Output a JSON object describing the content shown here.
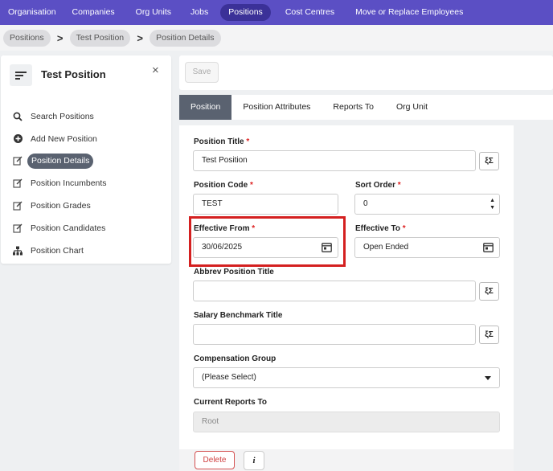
{
  "topnav": {
    "items": [
      {
        "label": "Organisation"
      },
      {
        "label": "Companies"
      },
      {
        "label": "Org Units"
      },
      {
        "label": "Jobs"
      },
      {
        "label": "Positions",
        "active": true
      },
      {
        "label": "Cost Centres"
      },
      {
        "label": "Move or Replace Employees"
      }
    ]
  },
  "breadcrumb": {
    "items": [
      "Positions",
      "Test Position",
      "Position Details"
    ],
    "separator": ">"
  },
  "leftpanel": {
    "title": "Test Position",
    "close_label": "×",
    "items": [
      {
        "label": "Search Positions",
        "icon": "search-icon"
      },
      {
        "label": "Add New Position",
        "icon": "plus-circle-icon"
      },
      {
        "label": "Position Details",
        "icon": "edit-icon",
        "active": true
      },
      {
        "label": "Position Incumbents",
        "icon": "edit-icon"
      },
      {
        "label": "Position Grades",
        "icon": "edit-icon"
      },
      {
        "label": "Position Candidates",
        "icon": "edit-icon"
      },
      {
        "label": "Position Chart",
        "icon": "hierarchy-icon"
      }
    ]
  },
  "toolbar": {
    "save_label": "Save"
  },
  "tabs": [
    {
      "label": "Position",
      "active": true
    },
    {
      "label": "Position Attributes"
    },
    {
      "label": "Reports To"
    },
    {
      "label": "Org Unit"
    }
  ],
  "form": {
    "position_title": {
      "label": "Position Title",
      "required": "*",
      "value": "Test Position"
    },
    "position_code": {
      "label": "Position Code",
      "required": "*",
      "value": "TEST"
    },
    "sort_order": {
      "label": "Sort Order",
      "required": "*",
      "value": "0"
    },
    "effective_from": {
      "label": "Effective From",
      "required": "*",
      "value": "30/06/2025"
    },
    "effective_to": {
      "label": "Effective To",
      "required": "*",
      "value": "Open Ended"
    },
    "abbrev_title": {
      "label": "Abbrev Position Title",
      "value": ""
    },
    "salary_benchmark": {
      "label": "Salary Benchmark Title",
      "value": ""
    },
    "compensation_group": {
      "label": "Compensation Group",
      "value": "(Please Select)"
    },
    "current_reports_to": {
      "label": "Current Reports To",
      "value": "Root"
    },
    "translate_label": "ξΣ"
  },
  "footer": {
    "delete_label": "Delete",
    "info_label": "i"
  },
  "colors": {
    "nav_bg": "#5b4fc4",
    "nav_active": "#3b3198",
    "tab_active": "#5a6270",
    "highlight": "#d42020",
    "required": "#dd2222"
  }
}
